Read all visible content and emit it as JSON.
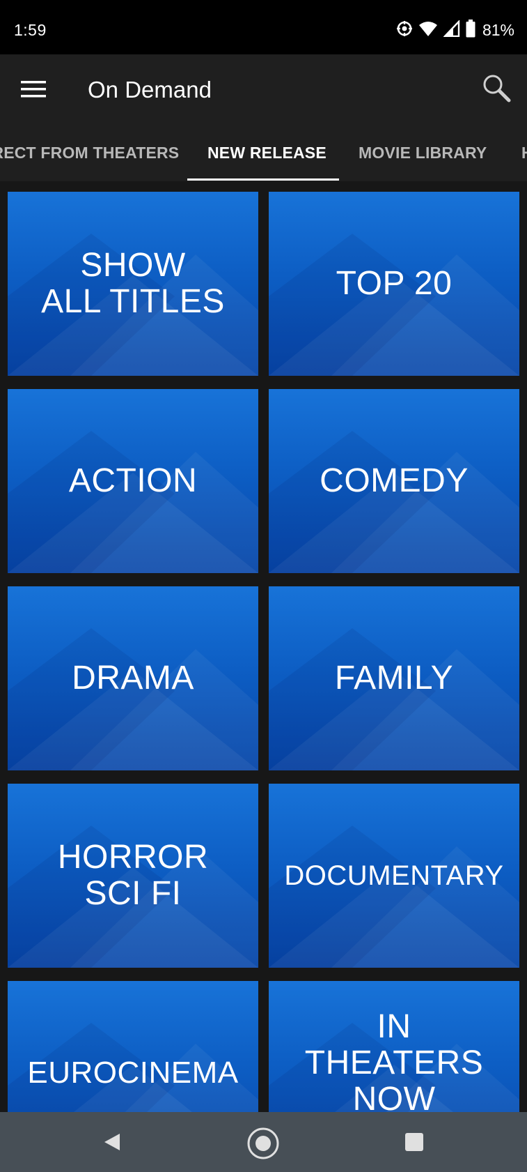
{
  "status_bar": {
    "time": "1:59",
    "battery": "81%",
    "icons": [
      "location-icon",
      "wifi-icon",
      "signal-icon",
      "battery-icon"
    ]
  },
  "app_bar": {
    "title": "On Demand",
    "menu_icon": "hamburger-menu-icon",
    "search_icon": "search-icon"
  },
  "tabs": [
    {
      "label": "DIRECT FROM THEATERS",
      "active": false
    },
    {
      "label": "NEW RELEASE",
      "active": true
    },
    {
      "label": "MOVIE LIBRARY",
      "active": false
    },
    {
      "label": "H",
      "active": false
    }
  ],
  "tiles": [
    {
      "label": "SHOW\nALL TITLES"
    },
    {
      "label": "TOP 20"
    },
    {
      "label": "ACTION"
    },
    {
      "label": "COMEDY"
    },
    {
      "label": "DRAMA"
    },
    {
      "label": "FAMILY"
    },
    {
      "label": "HORROR\nSCI FI"
    },
    {
      "label": "DOCUMENTARY"
    },
    {
      "label": "EUROCINEMA"
    },
    {
      "label": "IN\nTHEATERS\nNOW"
    }
  ],
  "colors": {
    "tile_top": "#1873d8",
    "tile_bottom": "#0746a8",
    "app_bg": "#1f1f1f",
    "nav_bg": "#474f56"
  },
  "nav_bar": {
    "back_icon": "back-triangle-icon",
    "home_icon": "home-circle-icon",
    "recents_icon": "recents-square-icon"
  }
}
